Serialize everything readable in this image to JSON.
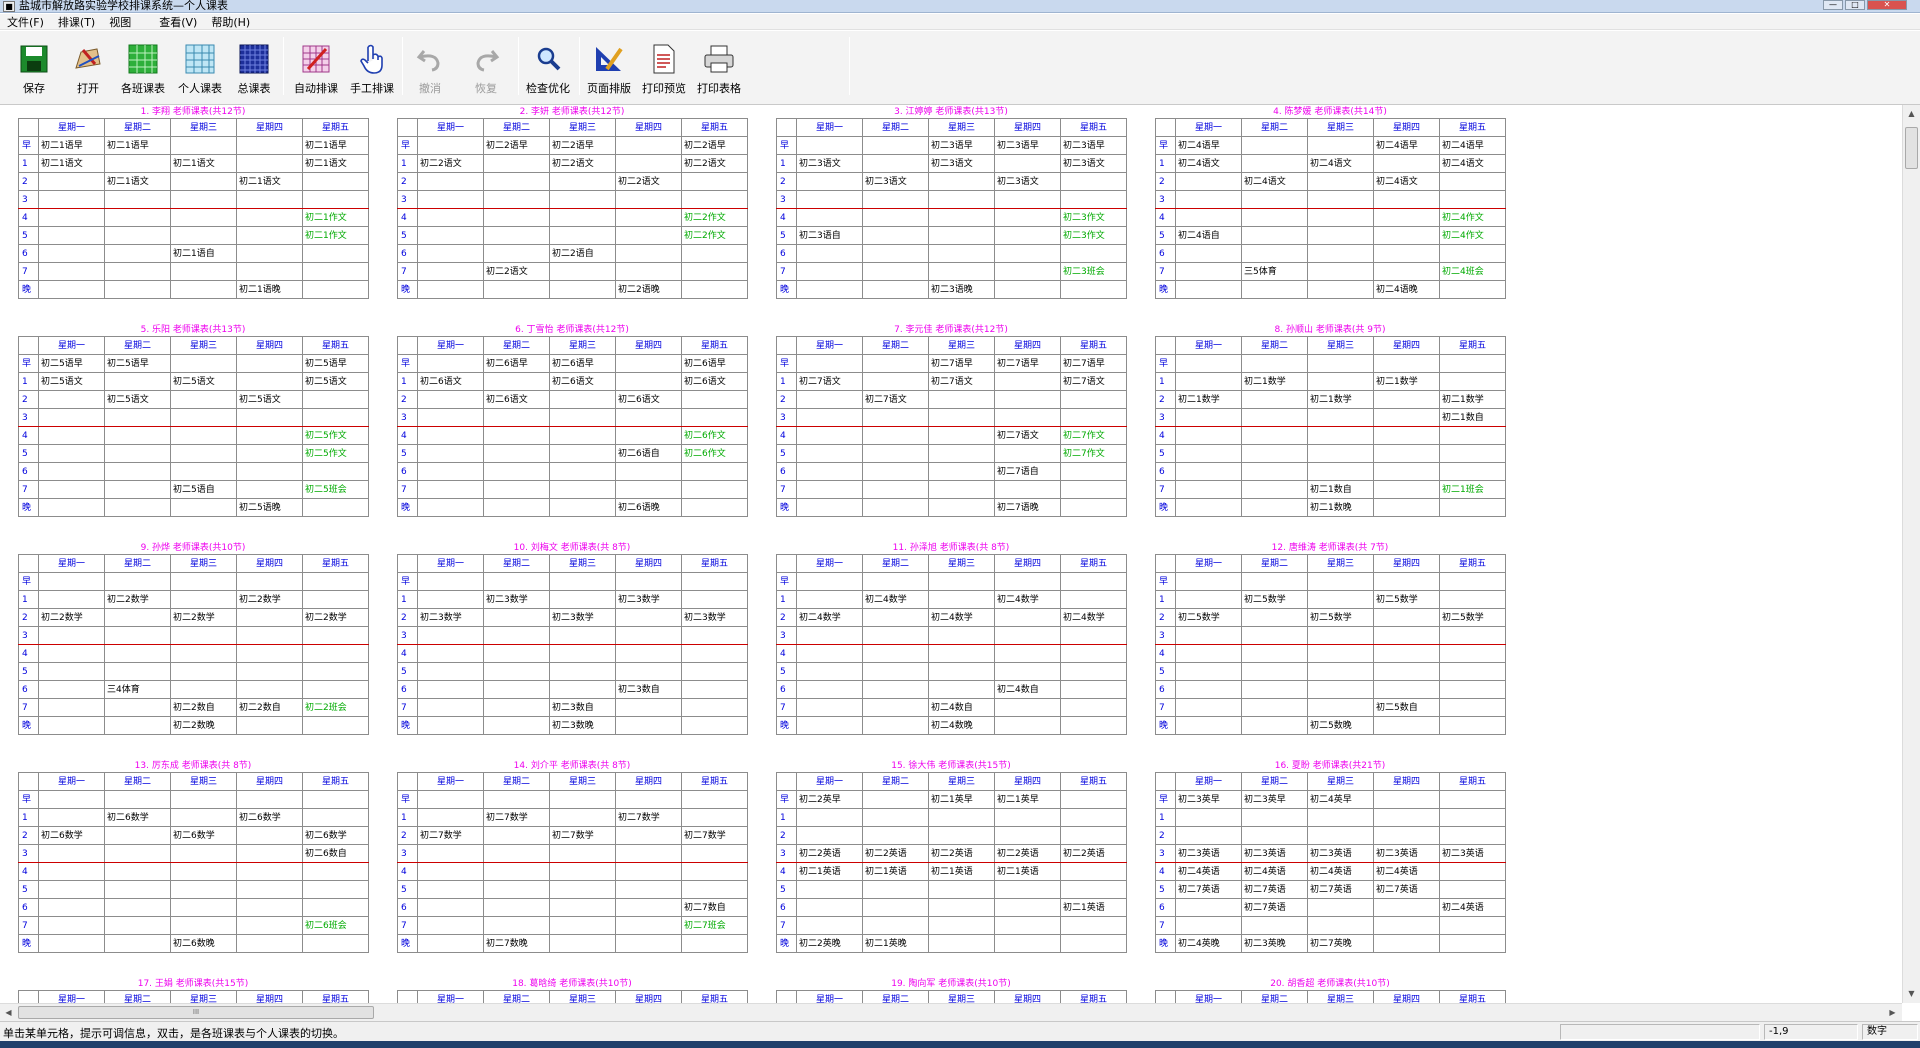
{
  "window": {
    "title": "盐城市解放路实验学校排课系统—个人课表"
  },
  "menu": [
    "文件(F)",
    "排课(T)",
    "视图",
    "查看(V)",
    "帮助(H)"
  ],
  "toolbar": {
    "buttons": [
      {
        "label": "保存",
        "icon": "save-icon"
      },
      {
        "label": "打开",
        "icon": "open-icon"
      },
      {
        "label": "各班课表",
        "icon": "class-schedule-icon"
      },
      {
        "label": "个人课表",
        "icon": "personal-schedule-icon"
      },
      {
        "label": "总课表",
        "icon": "master-schedule-icon"
      },
      {
        "label": "自动排课",
        "icon": "auto-schedule-icon"
      },
      {
        "label": "手工排课",
        "icon": "hand-pointer-icon"
      },
      {
        "label": "撤消",
        "icon": "undo-icon",
        "disabled": true
      },
      {
        "label": "恢复",
        "icon": "redo-icon",
        "disabled": true
      },
      {
        "label": "检查优化",
        "icon": "magnifier-icon"
      },
      {
        "label": "页面排版",
        "icon": "page-layout-icon"
      },
      {
        "label": "打印预览",
        "icon": "print-preview-icon"
      },
      {
        "label": "打印表格",
        "icon": "printer-icon"
      }
    ]
  },
  "days": [
    "星期一",
    "星期二",
    "星期三",
    "星期四",
    "星期五"
  ],
  "periods": [
    "早",
    "1",
    "2",
    "3",
    "4",
    "5",
    "6",
    "7",
    "晚"
  ],
  "timetables": [
    {
      "title": "1. 李翔  老师课表(共12节)",
      "rows": [
        [
          "初二1语早",
          "初二1语早",
          "",
          "",
          "初二1语早"
        ],
        [
          "初二1语文",
          "",
          "初二1语文",
          "",
          "初二1语文"
        ],
        [
          "",
          "初二1语文",
          "",
          "初二1语文",
          ""
        ],
        [
          "",
          "",
          "",
          "",
          ""
        ],
        [
          "",
          "",
          "",
          "",
          "初二1作文"
        ],
        [
          "",
          "",
          "",
          "",
          "初二1作文"
        ],
        [
          "",
          "",
          "初二1语自",
          "",
          ""
        ],
        [
          "",
          "",
          "",
          "",
          ""
        ],
        [
          "",
          "",
          "",
          "初二1语晚",
          ""
        ]
      ]
    },
    {
      "title": "2. 李妍  老师课表(共12节)",
      "rows": [
        [
          "",
          "初二2语早",
          "初二2语早",
          "",
          "初二2语早"
        ],
        [
          "初二2语文",
          "",
          "初二2语文",
          "",
          "初二2语文"
        ],
        [
          "",
          "",
          "",
          "初二2语文",
          ""
        ],
        [
          "",
          "",
          "",
          "",
          ""
        ],
        [
          "",
          "",
          "",
          "",
          "初二2作文"
        ],
        [
          "",
          "",
          "",
          "",
          "初二2作文"
        ],
        [
          "",
          "",
          "初二2语自",
          "",
          ""
        ],
        [
          "",
          "初二2语文",
          "",
          "",
          ""
        ],
        [
          "",
          "",
          "",
          "初二2语晚",
          ""
        ]
      ]
    },
    {
      "title": "3. 江婷婷  老师课表(共13节)",
      "rows": [
        [
          "",
          "",
          "初二3语早",
          "初二3语早",
          "初二3语早"
        ],
        [
          "初二3语文",
          "",
          "初二3语文",
          "",
          "初二3语文"
        ],
        [
          "",
          "初二3语文",
          "",
          "初二3语文",
          ""
        ],
        [
          "",
          "",
          "",
          "",
          ""
        ],
        [
          "",
          "",
          "",
          "",
          "初二3作文"
        ],
        [
          "初二3语自",
          "",
          "",
          "",
          "初二3作文"
        ],
        [
          "",
          "",
          "",
          "",
          ""
        ],
        [
          "",
          "",
          "",
          "",
          "初二3班会"
        ],
        [
          "",
          "",
          "初二3语晚",
          "",
          ""
        ]
      ]
    },
    {
      "title": "4. 陈梦媛  老师课表(共14节)",
      "rows": [
        [
          "初二4语早",
          "",
          "",
          "初二4语早",
          "初二4语早"
        ],
        [
          "初二4语文",
          "",
          "初二4语文",
          "",
          "初二4语文"
        ],
        [
          "",
          "初二4语文",
          "",
          "初二4语文",
          ""
        ],
        [
          "",
          "",
          "",
          "",
          ""
        ],
        [
          "",
          "",
          "",
          "",
          "初二4作文"
        ],
        [
          "初二4语自",
          "",
          "",
          "",
          "初二4作文"
        ],
        [
          "",
          "",
          "",
          "",
          ""
        ],
        [
          "",
          "三5体育",
          "",
          "",
          "初二4班会"
        ],
        [
          "",
          "",
          "",
          "初二4语晚",
          ""
        ]
      ]
    },
    {
      "title": "5. 乐阳  老师课表(共13节)",
      "rows": [
        [
          "初二5语早",
          "初二5语早",
          "",
          "",
          "初二5语早"
        ],
        [
          "初二5语文",
          "",
          "初二5语文",
          "",
          "初二5语文"
        ],
        [
          "",
          "初二5语文",
          "",
          "初二5语文",
          ""
        ],
        [
          "",
          "",
          "",
          "",
          ""
        ],
        [
          "",
          "",
          "",
          "",
          "初二5作文"
        ],
        [
          "",
          "",
          "",
          "",
          "初二5作文"
        ],
        [
          "",
          "",
          "",
          "",
          ""
        ],
        [
          "",
          "",
          "初二5语自",
          "",
          "初二5班会"
        ],
        [
          "",
          "",
          "",
          "初二5语晚",
          ""
        ]
      ]
    },
    {
      "title": "6. 丁雪怡  老师课表(共12节)",
      "rows": [
        [
          "",
          "初二6语早",
          "初二6语早",
          "",
          "初二6语早"
        ],
        [
          "初二6语文",
          "",
          "初二6语文",
          "",
          "初二6语文"
        ],
        [
          "",
          "初二6语文",
          "",
          "初二6语文",
          ""
        ],
        [
          "",
          "",
          "",
          "",
          ""
        ],
        [
          "",
          "",
          "",
          "",
          "初二6作文"
        ],
        [
          "",
          "",
          "",
          "初二6语自",
          "初二6作文"
        ],
        [
          "",
          "",
          "",
          "",
          ""
        ],
        [
          "",
          "",
          "",
          "",
          ""
        ],
        [
          "",
          "",
          "",
          "初二6语晚",
          ""
        ]
      ]
    },
    {
      "title": "7. 李元佳  老师课表(共12节)",
      "rows": [
        [
          "",
          "",
          "初二7语早",
          "初二7语早",
          "初二7语早"
        ],
        [
          "初二7语文",
          "",
          "初二7语文",
          "",
          "初二7语文"
        ],
        [
          "",
          "初二7语文",
          "",
          "",
          ""
        ],
        [
          "",
          "",
          "",
          "",
          ""
        ],
        [
          "",
          "",
          "",
          "初二7语文",
          "初二7作文"
        ],
        [
          "",
          "",
          "",
          "",
          "初二7作文"
        ],
        [
          "",
          "",
          "",
          "初二7语自",
          ""
        ],
        [
          "",
          "",
          "",
          "",
          ""
        ],
        [
          "",
          "",
          "",
          "初二7语晚",
          ""
        ]
      ]
    },
    {
      "title": "8. 孙顺山  老师课表(共 9节)",
      "rows": [
        [
          "",
          "",
          "",
          "",
          ""
        ],
        [
          "",
          "初二1数学",
          "",
          "初二1数学",
          ""
        ],
        [
          "初二1数学",
          "",
          "初二1数学",
          "",
          "初二1数学"
        ],
        [
          "",
          "",
          "",
          "",
          "初二1数自"
        ],
        [
          "",
          "",
          "",
          "",
          ""
        ],
        [
          "",
          "",
          "",
          "",
          ""
        ],
        [
          "",
          "",
          "",
          "",
          ""
        ],
        [
          "",
          "",
          "初二1数自",
          "",
          "初二1班会"
        ],
        [
          "",
          "",
          "初二1数晚",
          "",
          ""
        ]
      ]
    },
    {
      "title": "9. 孙烨  老师课表(共10节)",
      "rows": [
        [
          "",
          "",
          "",
          "",
          ""
        ],
        [
          "",
          "初二2数学",
          "",
          "初二2数学",
          ""
        ],
        [
          "初二2数学",
          "",
          "初二2数学",
          "",
          "初二2数学"
        ],
        [
          "",
          "",
          "",
          "",
          ""
        ],
        [
          "",
          "",
          "",
          "",
          ""
        ],
        [
          "",
          "",
          "",
          "",
          ""
        ],
        [
          "",
          "三4体育",
          "",
          "",
          ""
        ],
        [
          "",
          "",
          "初二2数自",
          "初二2数自",
          "初二2班会"
        ],
        [
          "",
          "",
          "初二2数晚",
          "",
          ""
        ]
      ]
    },
    {
      "title": "10. 刘梅文  老师课表(共 8节)",
      "rows": [
        [
          "",
          "",
          "",
          "",
          ""
        ],
        [
          "",
          "初二3数学",
          "",
          "初二3数学",
          ""
        ],
        [
          "初二3数学",
          "",
          "初二3数学",
          "",
          "初二3数学"
        ],
        [
          "",
          "",
          "",
          "",
          ""
        ],
        [
          "",
          "",
          "",
          "",
          ""
        ],
        [
          "",
          "",
          "",
          "",
          ""
        ],
        [
          "",
          "",
          "",
          "初二3数自",
          ""
        ],
        [
          "",
          "",
          "初二3数自",
          "",
          ""
        ],
        [
          "",
          "",
          "初二3数晚",
          "",
          ""
        ]
      ]
    },
    {
      "title": "11. 孙泽旭  老师课表(共 8节)",
      "rows": [
        [
          "",
          "",
          "",
          "",
          ""
        ],
        [
          "",
          "初二4数学",
          "",
          "初二4数学",
          ""
        ],
        [
          "初二4数学",
          "",
          "初二4数学",
          "",
          "初二4数学"
        ],
        [
          "",
          "",
          "",
          "",
          ""
        ],
        [
          "",
          "",
          "",
          "",
          ""
        ],
        [
          "",
          "",
          "",
          "",
          ""
        ],
        [
          "",
          "",
          "",
          "初二4数自",
          ""
        ],
        [
          "",
          "",
          "初二4数自",
          "",
          ""
        ],
        [
          "",
          "",
          "初二4数晚",
          "",
          ""
        ]
      ]
    },
    {
      "title": "12. 唐维涛  老师课表(共 7节)",
      "rows": [
        [
          "",
          "",
          "",
          "",
          ""
        ],
        [
          "",
          "初二5数学",
          "",
          "初二5数学",
          ""
        ],
        [
          "初二5数学",
          "",
          "初二5数学",
          "",
          "初二5数学"
        ],
        [
          "",
          "",
          "",
          "",
          ""
        ],
        [
          "",
          "",
          "",
          "",
          ""
        ],
        [
          "",
          "",
          "",
          "",
          ""
        ],
        [
          "",
          "",
          "",
          "",
          ""
        ],
        [
          "",
          "",
          "",
          "初二5数自",
          ""
        ],
        [
          "",
          "",
          "初二5数晚",
          "",
          ""
        ]
      ]
    },
    {
      "title": "13. 厉东成  老师课表(共 8节)",
      "rows": [
        [
          "",
          "",
          "",
          "",
          ""
        ],
        [
          "",
          "初二6数学",
          "",
          "初二6数学",
          ""
        ],
        [
          "初二6数学",
          "",
          "初二6数学",
          "",
          "初二6数学"
        ],
        [
          "",
          "",
          "",
          "",
          "初二6数自"
        ],
        [
          "",
          "",
          "",
          "",
          ""
        ],
        [
          "",
          "",
          "",
          "",
          ""
        ],
        [
          "",
          "",
          "",
          "",
          ""
        ],
        [
          "",
          "",
          "",
          "",
          "初二6班会"
        ],
        [
          "",
          "",
          "初二6数晚",
          "",
          ""
        ]
      ]
    },
    {
      "title": "14. 刘介平  老师课表(共 8节)",
      "rows": [
        [
          "",
          "",
          "",
          "",
          ""
        ],
        [
          "",
          "初二7数学",
          "",
          "初二7数学",
          ""
        ],
        [
          "初二7数学",
          "",
          "初二7数学",
          "",
          "初二7数学"
        ],
        [
          "",
          "",
          "",
          "",
          ""
        ],
        [
          "",
          "",
          "",
          "",
          ""
        ],
        [
          "",
          "",
          "",
          "",
          ""
        ],
        [
          "",
          "",
          "",
          "",
          "初二7数自"
        ],
        [
          "",
          "",
          "",
          "",
          "初二7班会"
        ],
        [
          "",
          "初二7数晚",
          "",
          "",
          ""
        ]
      ]
    },
    {
      "title": "15. 徐大伟  老师课表(共15节)",
      "rows": [
        [
          "初二2英早",
          "",
          "初二1英早",
          "初二1英早",
          ""
        ],
        [
          "",
          "",
          "",
          "",
          ""
        ],
        [
          "",
          "",
          "",
          "",
          ""
        ],
        [
          "初二2英语",
          "初二2英语",
          "初二2英语",
          "初二2英语",
          "初二2英语"
        ],
        [
          "初二1英语",
          "初二1英语",
          "初二1英语",
          "初二1英语",
          ""
        ],
        [
          "",
          "",
          "",
          "",
          ""
        ],
        [
          "",
          "",
          "",
          "",
          "初二1英语"
        ],
        [
          "",
          "",
          "",
          "",
          ""
        ],
        [
          "初二2英晚",
          "初二1英晚",
          "",
          "",
          ""
        ]
      ]
    },
    {
      "title": "16. 夏盼  老师课表(共21节)",
      "rows": [
        [
          "初二3英早",
          "初二3英早",
          "初二4英早",
          "",
          ""
        ],
        [
          "",
          "",
          "",
          "",
          ""
        ],
        [
          "",
          "",
          "",
          "",
          ""
        ],
        [
          "初二3英语",
          "初二3英语",
          "初二3英语",
          "初二3英语",
          "初二3英语"
        ],
        [
          "初二4英语",
          "初二4英语",
          "初二4英语",
          "初二4英语",
          ""
        ],
        [
          "初二7英语",
          "初二7英语",
          "初二7英语",
          "初二7英语",
          ""
        ],
        [
          "",
          "初二7英语",
          "",
          "",
          "初二4英语"
        ],
        [
          "",
          "",
          "",
          "",
          ""
        ],
        [
          "初二4英晚",
          "初二3英晚",
          "初二7英晚",
          "",
          ""
        ]
      ]
    }
  ],
  "bottom_titles": [
    "17. 王娟  老师课表(共15节)",
    "18. 葛晗绮  老师课表(共10节)",
    "19. 陶向军  老师课表(共10节)",
    "20. 胡香超  老师课表(共10节)"
  ],
  "status": {
    "message": "单击某单元格，提示可调信息，双击，是各班课表与个人课表的切换。",
    "coords": "-1,9",
    "mode": "数字"
  },
  "scrollbar": {
    "thumb_grip": "III"
  },
  "colors": {
    "title": "#ee00ee",
    "header": "#0000dd",
    "green": "#00aa00",
    "break_line": "#cc0000"
  }
}
